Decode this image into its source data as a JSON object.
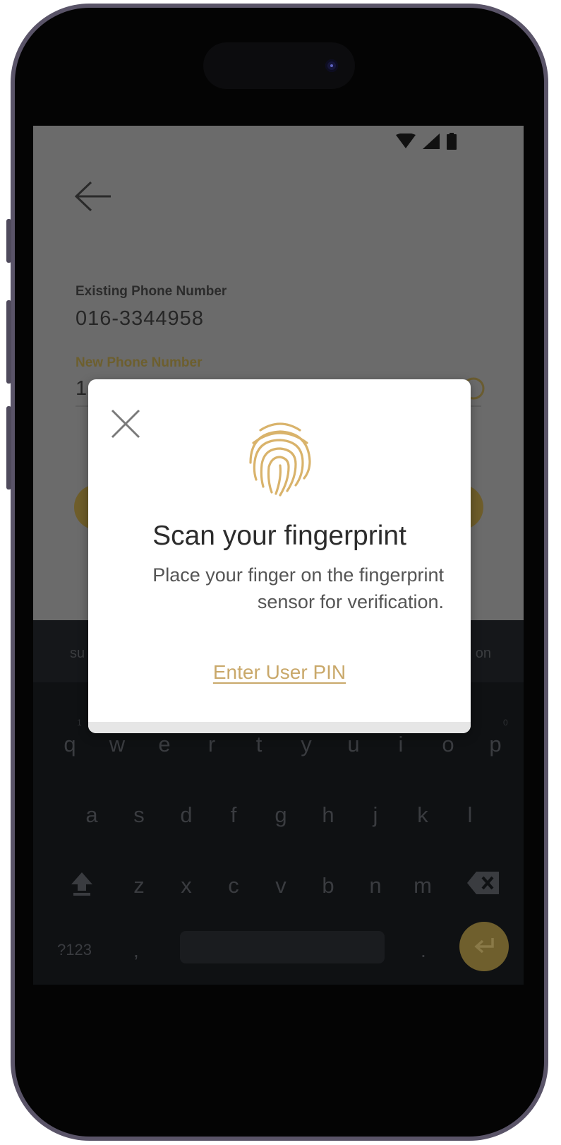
{
  "status_bar": {
    "icons": [
      "wifi-icon",
      "signal-icon",
      "battery-icon"
    ]
  },
  "form": {
    "existing_label": "Existing Phone Number",
    "existing_value": "016-3344958",
    "new_label": "New Phone Number",
    "new_value": "1"
  },
  "keyboard": {
    "suggestions": {
      "left": "su",
      "right": "on"
    },
    "row1": [
      "q",
      "w",
      "e",
      "r",
      "t",
      "y",
      "u",
      "i",
      "o",
      "p"
    ],
    "row1_hints": {
      "first": "1",
      "last": "0"
    },
    "row2": [
      "a",
      "s",
      "d",
      "f",
      "g",
      "h",
      "j",
      "k",
      "l"
    ],
    "row3": [
      "z",
      "x",
      "c",
      "v",
      "b",
      "n",
      "m"
    ],
    "symbols_label": "?123",
    "comma": ",",
    "period": "."
  },
  "dialog": {
    "title": "Scan your fingerprint",
    "message_line1": "Place your finger on the fingerprint",
    "message_line2": "sensor for verification.",
    "link": "Enter User PIN"
  },
  "colors": {
    "accent_gold": "#c9a86a",
    "overlay_gray": "#6b6b6b",
    "keyboard_bg": "#0f1113"
  }
}
